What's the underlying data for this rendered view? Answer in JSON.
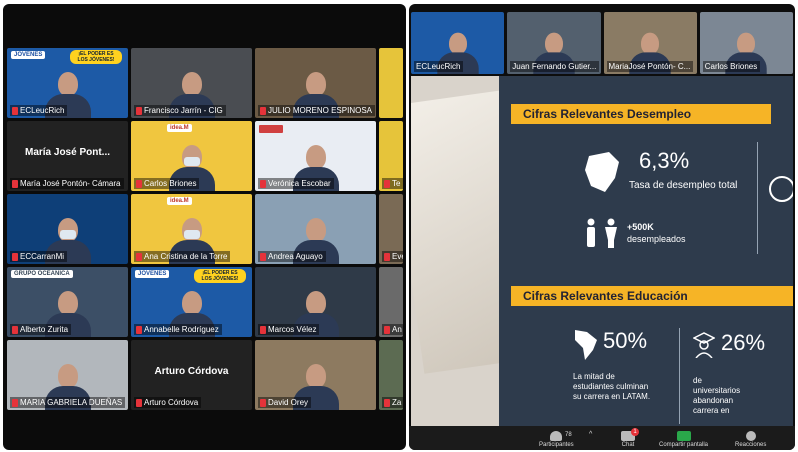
{
  "left_grid": {
    "tiles": [
      {
        "name": "ECLeucRich",
        "bg": "#1d5aa6",
        "kind": "jovenes"
      },
      {
        "name": "Francisco Jarrín - CIG",
        "bg": "#4a4d52",
        "kind": "person"
      },
      {
        "name": "JULIO MORENO ESPINOSA",
        "bg": "#6b5a45",
        "kind": "person"
      },
      {
        "name": "",
        "bg": "#e6c43a",
        "kind": "edge"
      },
      {
        "name": "María José Pontón- Cámara",
        "bg": "#222222",
        "kind": "text",
        "center": "María José Pont..."
      },
      {
        "name": "Carlos Briones",
        "bg": "#f0c63f",
        "kind": "idea"
      },
      {
        "name": "Verónica Escobar",
        "bg": "#e9edf3",
        "kind": "fidela"
      },
      {
        "name": "Te",
        "bg": "#e6c43a",
        "kind": "edge"
      },
      {
        "name": "ECCarranMi",
        "bg": "#0e3f78",
        "kind": "mask"
      },
      {
        "name": "Ana Cristina de la Torre",
        "bg": "#f0c63f",
        "kind": "idea"
      },
      {
        "name": "Andrea Aguayo",
        "bg": "#8aa0b4",
        "kind": "person"
      },
      {
        "name": "Eve",
        "bg": "#7a6a55",
        "kind": "edge"
      },
      {
        "name": "Alberto Zurita",
        "bg": "#3c4f66",
        "kind": "oceanica"
      },
      {
        "name": "Annabelle Rodríguez",
        "bg": "#1d5aa6",
        "kind": "jovenes"
      },
      {
        "name": "Marcos Vélez",
        "bg": "#2f3a48",
        "kind": "person"
      },
      {
        "name": "An",
        "bg": "#6a6a6a",
        "kind": "edge"
      },
      {
        "name": "MARIA GABRIELA DUEÑAS",
        "bg": "#b2b7bc",
        "kind": "person"
      },
      {
        "name": "Arturo Córdova",
        "bg": "#222222",
        "kind": "text",
        "center": "Arturo Córdova"
      },
      {
        "name": "David Orey",
        "bg": "#8d7a60",
        "kind": "person"
      },
      {
        "name": "Za",
        "bg": "#5c6b52",
        "kind": "edge"
      }
    ],
    "jovenes_label": "JÓVENES",
    "poder_label": "¡EL PODER ES LOS JÓVENES!",
    "idea_label": "idea.M",
    "oceanica_label": "GRUPO OCEANICA"
  },
  "right_thumbs": [
    {
      "name": "ECLeucRich",
      "bg": "#1d5aa6"
    },
    {
      "name": "Juan Fernando Gutier...",
      "bg": "#53606e"
    },
    {
      "name": "MariaJosé Pontón- C...",
      "bg": "#8a7b64"
    },
    {
      "name": "Carlos Briones",
      "bg": "#7c8794"
    }
  ],
  "slide": {
    "desempleo_title": "Cifras Relevantes Desempleo",
    "pct1": "6,3%",
    "pct1_label": "Tasa de desempleo total",
    "count": "+500K",
    "count_label": "desempleados",
    "educacion_title": "Cifras Relevantes Educación",
    "pct2": "50%",
    "pct2_label": "La mitad de estudiantes culminan su carrera en LATAM.",
    "pct3": "26%",
    "pct3_label": "de universitarios abandonan carrera en"
  },
  "toolbar": {
    "participants_label": "Participantes",
    "participants_count": "78",
    "chat_label": "Chat",
    "chat_badge": "1",
    "share_label": "Compartir pantalla",
    "reactions_label": "Reacciones"
  },
  "colors": {
    "accent_yellow": "#f6b426",
    "slide_dark": "#2e3b4c",
    "share_green": "#2aa84a",
    "mic_red": "#e5333a"
  }
}
